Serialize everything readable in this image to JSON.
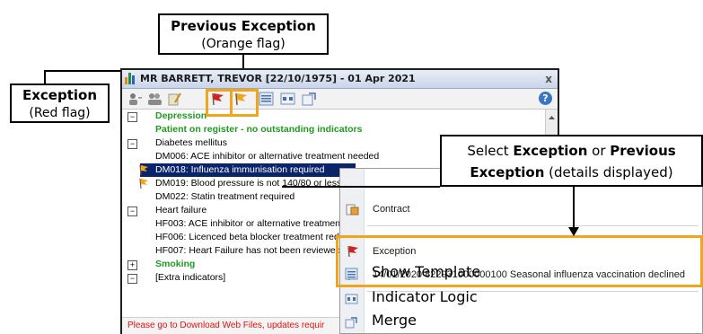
{
  "callouts": {
    "previous_exception_title": "Previous Exception",
    "previous_exception_sub": "(Orange flag)",
    "exception_title": "Exception",
    "exception_sub": "(Red flag)",
    "select_text_1": "Select ",
    "select_bold_1": "Exception",
    "select_text_2": " or ",
    "select_bold_2": "Previous",
    "select_bold_3": "Exception",
    "select_text_3": " (details displayed)"
  },
  "window": {
    "title": "MR BARRETT, TREVOR [22/10/1975] - 01 Apr 2021",
    "close": "x",
    "help": "?"
  },
  "tree": {
    "depression": "Depression",
    "on_register": "Patient on register - no outstanding indicators",
    "diabetes": "Diabetes mellitus",
    "dm006": "DM006: ACE inhibitor or alternative treatment needed",
    "dm018": "DM018: Influenza immunisation required",
    "dm019": "DM019: Blood pressure is not 140/80 or less",
    "dm022": "DM022: Statin treatment required",
    "heart_failure": "Heart failure",
    "hf003": "HF003: ACE inhibitor or alternative treatmen",
    "hf006": "HF006: Licenced beta blocker treatment red",
    "hf007": "HF007: Heart Failure has not been reviewed",
    "smoking": "Smoking",
    "extra": "[Extra indicators]",
    "minus": "−",
    "plus": "+"
  },
  "status": "Please go to Download Web Files, updates requir",
  "context_menu": {
    "contract": "Contract",
    "exception": "Exception",
    "previous_exception": "14/01/2020  822931000000100  Seasonal influenza vaccination declined",
    "show_template": "Show Template",
    "indicator_logic": "Indicator Logic",
    "merge": "Merge"
  },
  "colors": {
    "red_flag": "#d32020",
    "orange_flag": "#f0a61c",
    "green_text": "#1f9a1f",
    "selection": "#0a246a"
  }
}
